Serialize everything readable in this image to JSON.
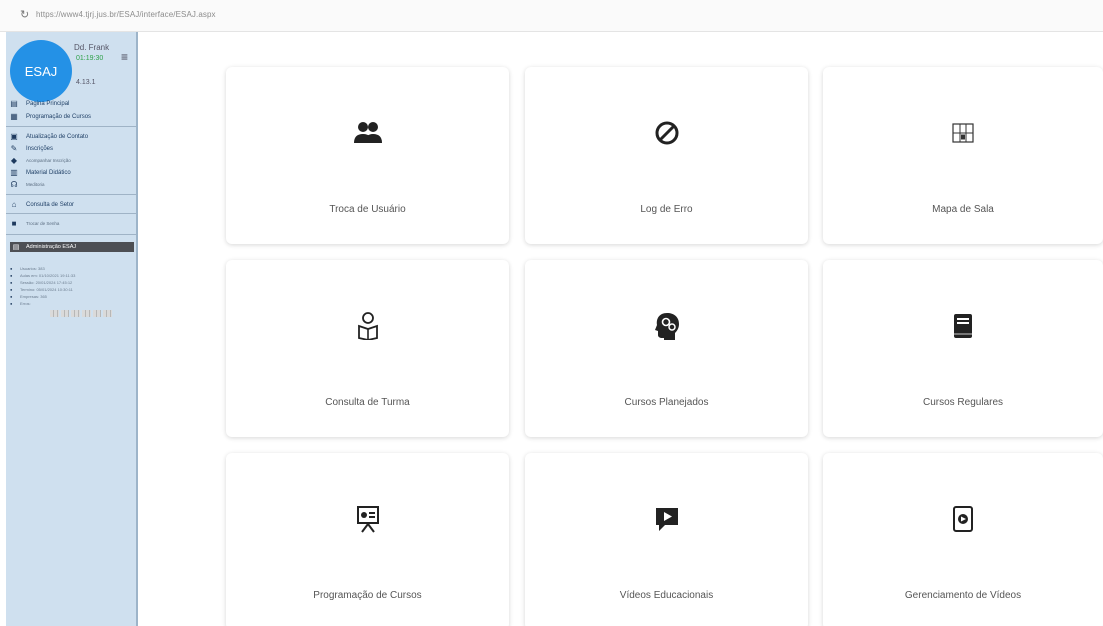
{
  "browser": {
    "url": "https://www4.tjrj.jus.br/ESAJ/interface/ESAJ.aspx",
    "reload_icon": "reload-icon"
  },
  "sidebar": {
    "avatar_text": "ESAJ",
    "user_name": "Dd. Frank",
    "user_time": "01:19:30",
    "version": "4.13.1",
    "menu_icon": "hamburger-icon",
    "items": [
      {
        "label": "Pagina Principal",
        "icon": "page-icon"
      },
      {
        "label": "Programação de Cursos",
        "icon": "calendar-icon"
      },
      {
        "label": "Atualização de Contato",
        "icon": "contact-card-icon"
      },
      {
        "label": "Inscrições",
        "icon": "enroll-icon"
      },
      {
        "label": "Acompanhar Inscrição",
        "icon": "follow-icon"
      },
      {
        "label": "Material Didático",
        "icon": "book-icon"
      },
      {
        "label": "Meditoria",
        "icon": "mentor-icon"
      },
      {
        "label": "Consulta de Setor",
        "icon": "building-icon"
      },
      {
        "label": "Trocar de Senha",
        "icon": "key-icon"
      }
    ],
    "admin_label": "Administração ESAJ",
    "stats": [
      {
        "text": "Usuarios: 383"
      },
      {
        "text": "Aulas em: 01/10/2021 19:11:33"
      },
      {
        "text": "Sessão: 20/01/2024 17:45:12"
      },
      {
        "text": "Termino: 05/01/2024 10:30:11"
      },
      {
        "text": "Empresas: 365"
      },
      {
        "text": "Erros:"
      }
    ]
  },
  "cards": [
    {
      "label": "Troca de Usuário",
      "icon": "users-icon"
    },
    {
      "label": "Log de Erro",
      "icon": "ban-icon"
    },
    {
      "label": "Mapa de Sala",
      "icon": "floor-map-icon"
    },
    {
      "label": "Consulta de Turma",
      "icon": "reading-person-icon"
    },
    {
      "label": "Cursos Planejados",
      "icon": "head-gears-icon"
    },
    {
      "label": "Cursos Regulares",
      "icon": "book-icon"
    },
    {
      "label": "Programação de Cursos",
      "icon": "presentation-board-icon"
    },
    {
      "label": "Vídeos Educacionais",
      "icon": "video-play-icon"
    },
    {
      "label": "Gerenciamento de Vídeos",
      "icon": "video-file-icon"
    }
  ]
}
